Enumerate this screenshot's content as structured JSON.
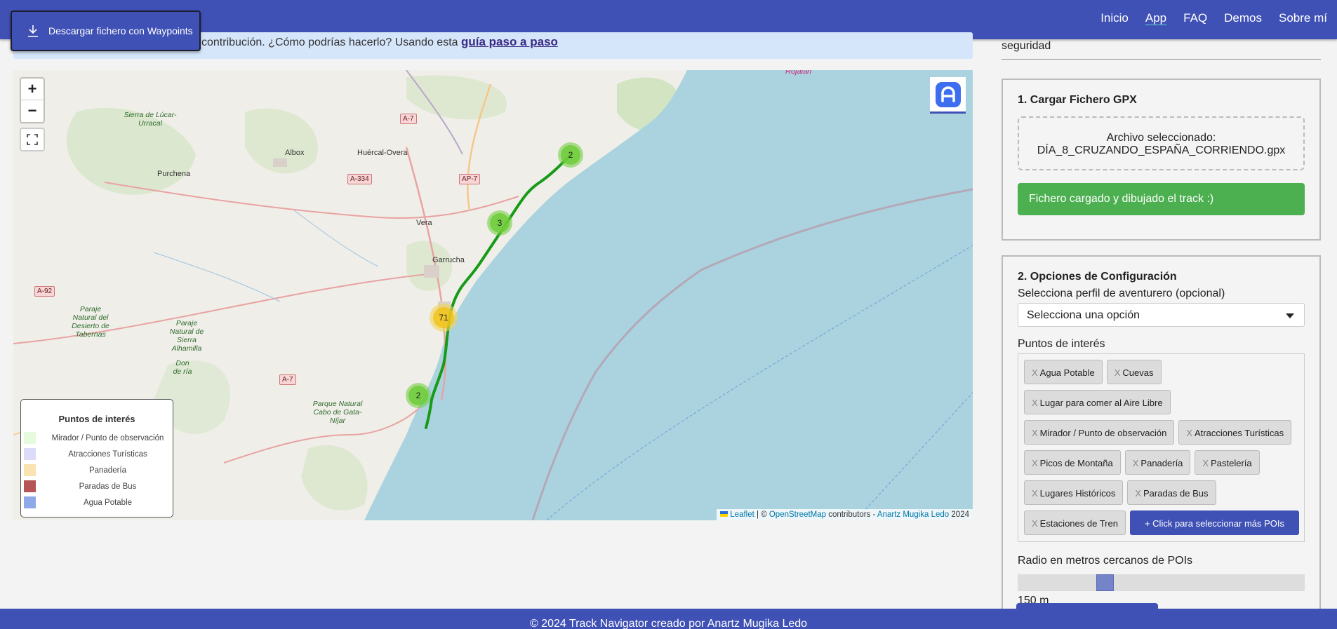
{
  "nav": {
    "items": [
      "Inicio",
      "App",
      "FAQ",
      "Demos",
      "Sobre mí"
    ],
    "active": "App"
  },
  "download_button": {
    "label": "Descargar fichero con Waypoints",
    "icon": "download-icon"
  },
  "banner": {
    "text": "contribución. ¿Cómo podrías hacerlo? Usando esta ",
    "link": "guía paso a paso"
  },
  "map": {
    "zoom_in": "+",
    "zoom_out": "−",
    "fullscreen_icon": "fullscreen-icon",
    "logo_icon": "app-logo-icon",
    "clusters": [
      "2",
      "3",
      "71",
      "2"
    ],
    "places": [
      "Albox",
      "Huércal-Overa",
      "Purchena",
      "Vera",
      "Garrucha",
      "Sierra de Lúcar-Urracal",
      "Rojalán"
    ],
    "roads": [
      "A-7",
      "A-334",
      "AP-7",
      "A-92",
      "A-7"
    ],
    "parks": [
      "Paraje Natural del Desierto de Tabernas",
      "Paraje Natural de Sierra Alhamilla",
      "Parque Natural Cabo de Gata-Níjar",
      "Don de ría"
    ],
    "legend": {
      "title": "Puntos de interés",
      "items": [
        {
          "label": "Mirador / Punto de observación",
          "color": "#e4fbdc"
        },
        {
          "label": "Atracciones Turísticas",
          "color": "#dcdcf8"
        },
        {
          "label": "Panadería",
          "color": "#fbe3b1"
        },
        {
          "label": "Paradas de Bus",
          "color": "#b55555"
        },
        {
          "label": "Agua Potable",
          "color": "#8ea9e8"
        }
      ]
    },
    "attribution": {
      "leaflet": "Leaflet",
      "sep": " | © ",
      "osm": "OpenStreetMap",
      "contrib": " contributors - ",
      "author": "Anartz Mugika Ledo",
      "year": " 2024"
    }
  },
  "panel": {
    "top_text": "seguridad",
    "card1": {
      "title": "1. Cargar Fichero GPX",
      "file_label": "Archivo seleccionado:",
      "file_name": "DÍA_8_CRUZANDO_ESPAÑA_CORRIENDO.gpx",
      "status": "Fichero cargado y dibujado el track :)"
    },
    "card2": {
      "title": "2. Opciones de Configuración",
      "profile_label": "Selecciona perfil de aventurero (opcional)",
      "profile_value": "Selecciona una opción",
      "poi_label": "Puntos de interés",
      "poi_chips": [
        "Agua Potable",
        "Cuevas",
        "Lugar para comer al Aire Libre",
        "Mirador / Punto de observación",
        "Atracciones Turísticas",
        "Picos de Montaña",
        "Panadería",
        "Pastelería",
        "Lugares Históricos",
        "Paradas de Bus",
        "Estaciones de Tren"
      ],
      "chip_remove": "X",
      "more_button": "+ Click para seleccionar más POIs",
      "radius_label": "Radio en metros cercanos de POIs",
      "radius_value": "150 m",
      "radius_fraction": 0.33
    }
  },
  "footer": "© 2024 Track Navigator creado por Anartz Mugika Ledo"
}
